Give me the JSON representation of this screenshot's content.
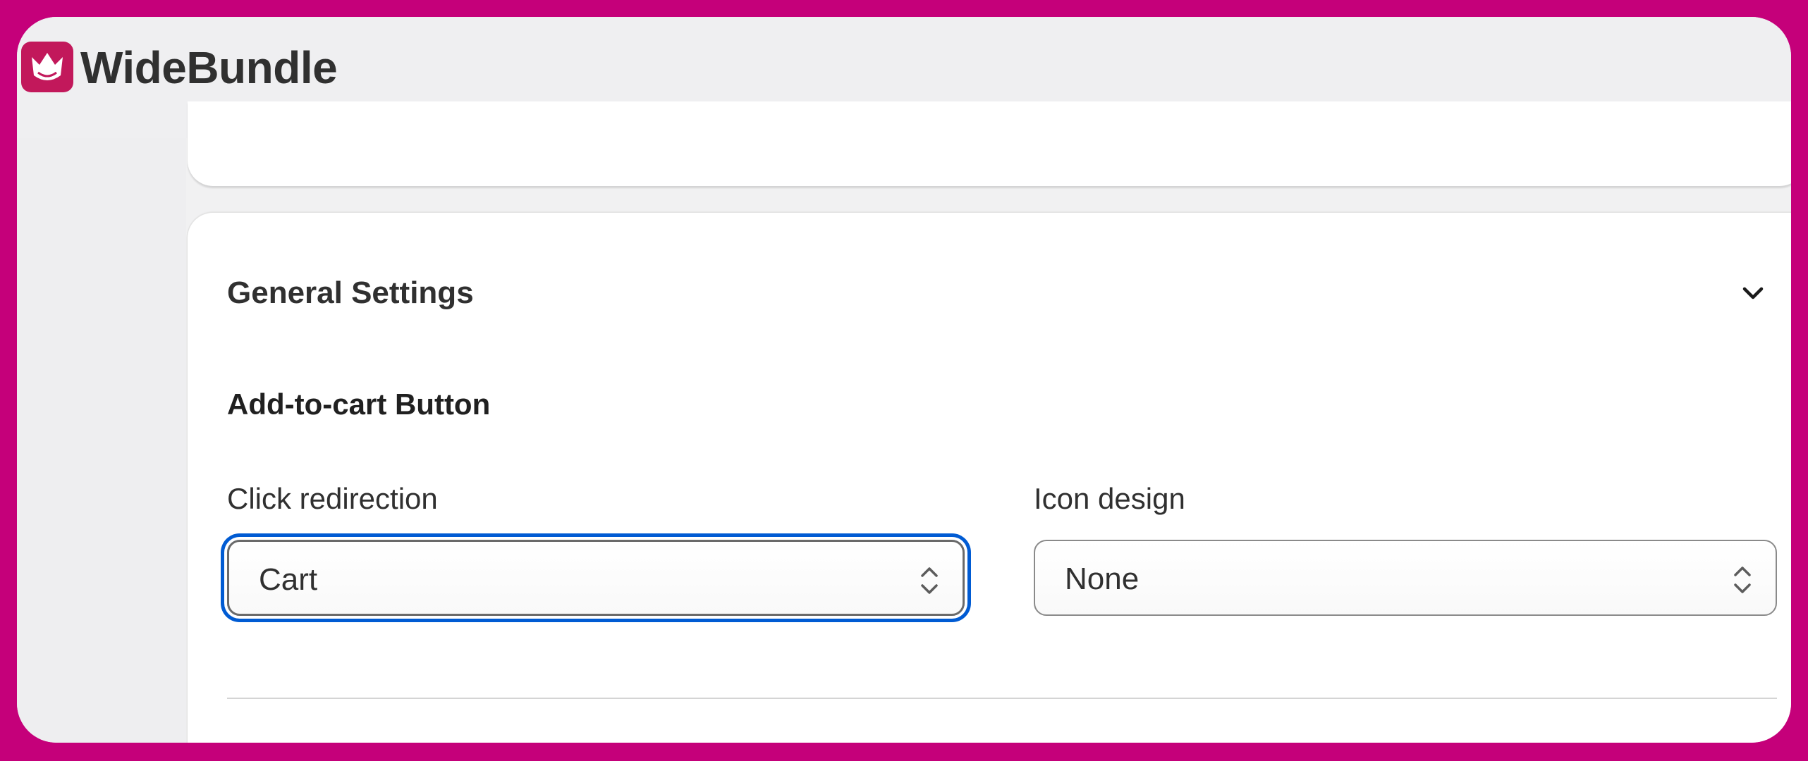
{
  "app": {
    "brand_name": "WideBundle",
    "brand_color": "#c2185b",
    "frame_color": "#c5007a",
    "focus_color": "#005bd3"
  },
  "general_settings": {
    "title": "General Settings",
    "toggle_icon": "chevron-down-icon",
    "add_to_cart": {
      "title": "Add-to-cart Button",
      "click_redirection": {
        "label": "Click redirection",
        "value": "Cart",
        "icon": "select-updown-icon"
      },
      "icon_design": {
        "label": "Icon design",
        "value": "None",
        "icon": "select-updown-icon"
      }
    }
  }
}
